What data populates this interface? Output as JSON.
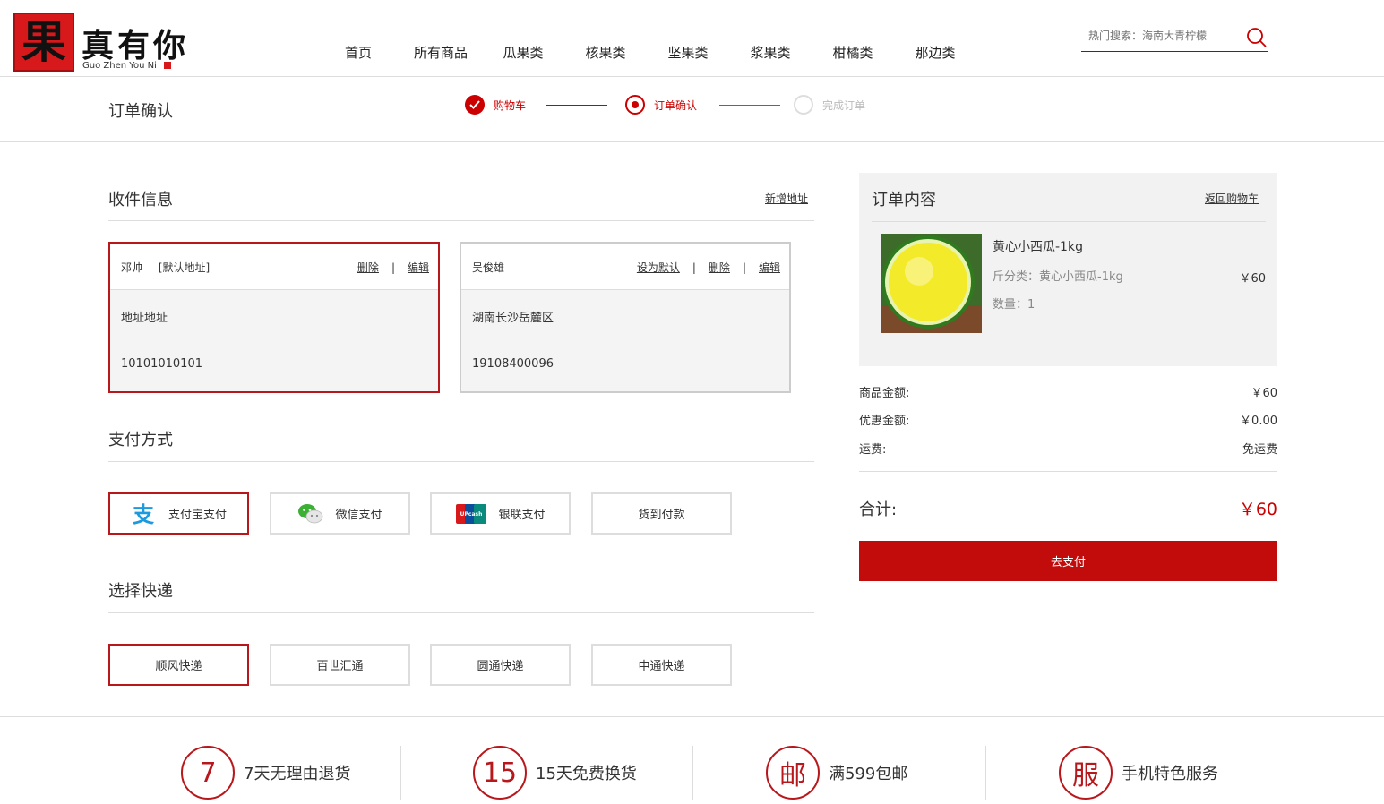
{
  "header": {
    "logo_char": "果",
    "logo_text": "真有你",
    "logo_en": "Guo Zhen You Ni",
    "nav": [
      "首页",
      "所有商品",
      "瓜果类",
      "核果类",
      "坚果类",
      "浆果类",
      "柑橘类",
      "那边类"
    ],
    "search_placeholder": "热门搜索：海南大青柠檬"
  },
  "steps": {
    "page_title": "订单确认",
    "items": [
      "购物车",
      "订单确认",
      "完成订单"
    ]
  },
  "address": {
    "title": "收件信息",
    "add_link": "新增地址",
    "cards": [
      {
        "name": "邓帅",
        "default_tag": "[默认地址]",
        "address": "地址地址",
        "phone": "10101010101",
        "actions": [
          "删除",
          "编辑"
        ]
      },
      {
        "name": "吴俊雄",
        "default_tag": "",
        "address": "湖南长沙岳麓区",
        "phone": "19108400096",
        "actions": [
          "设为默认",
          "删除",
          "编辑"
        ]
      }
    ]
  },
  "payment": {
    "title": "支付方式",
    "options": [
      "支付宝支付",
      "微信支付",
      "银联支付",
      "货到付款"
    ],
    "unionpay_logo_text": "UPcash"
  },
  "express": {
    "title": "选择快递",
    "options": [
      "顺风快递",
      "百世汇通",
      "圆通快递",
      "中通快递"
    ]
  },
  "order": {
    "title": "订单内容",
    "back_link": "返回购物车",
    "item": {
      "name": "黄心小西瓜-1kg",
      "spec_label": "斤分类：",
      "spec": "黄心小西瓜-1kg",
      "qty_label": "数量：",
      "qty": "1",
      "price": "￥60"
    },
    "summary": [
      {
        "label": "商品金额:",
        "value": "￥60"
      },
      {
        "label": "优惠金额:",
        "value": "￥0.00"
      },
      {
        "label": "运费:",
        "value": "免运费"
      }
    ],
    "total_label": "合计:",
    "total_value": "￥60",
    "pay_button": "去支付"
  },
  "services": [
    {
      "icon": "7",
      "text": "7天无理由退货"
    },
    {
      "icon": "15",
      "text": "15天免费换货"
    },
    {
      "icon": "邮",
      "text": "满599包邮"
    },
    {
      "icon": "服",
      "text": "手机特色服务"
    }
  ],
  "colors": {
    "accent": "#c20c0c",
    "border_selected": "#b8171c"
  }
}
